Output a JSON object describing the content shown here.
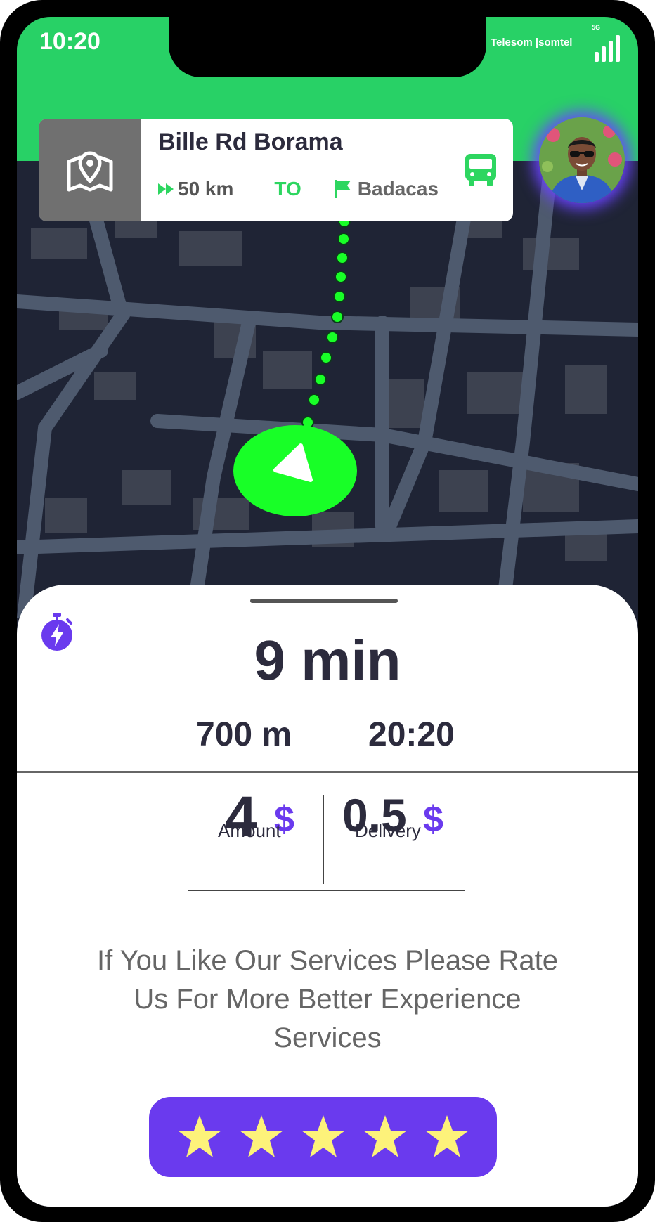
{
  "status_bar": {
    "time": "10:20",
    "carrier": "Telesom |somtel",
    "network": "5G"
  },
  "route": {
    "origin": "Bille Rd Borama",
    "distance": "50 km",
    "to_label": "TO",
    "destination": "Badacas"
  },
  "trip": {
    "eta": "9 min",
    "remaining_distance": "700 m",
    "arrival_time": "20:20"
  },
  "fare": {
    "amount_value": "4",
    "amount_currency": "$",
    "amount_label": "Amount",
    "delivery_value": "0.5",
    "delivery_currency": "$",
    "delivery_label": "Delivery"
  },
  "rating": {
    "message": "If You Like Our Services Please Rate Us For More Better Experience Services",
    "stars": 5
  },
  "colors": {
    "accent_green": "#28d166",
    "route_green": "#18ff27",
    "accent_purple": "#6a3aee",
    "star_yellow": "#fdf27a",
    "map_bg": "#1f2435"
  },
  "icons": [
    "signal-bars-icon",
    "map-pin-icon",
    "fast-forward-icon",
    "flag-icon",
    "bus-icon",
    "navigation-arrow-icon",
    "stopwatch-bolt-icon",
    "star-icon"
  ]
}
